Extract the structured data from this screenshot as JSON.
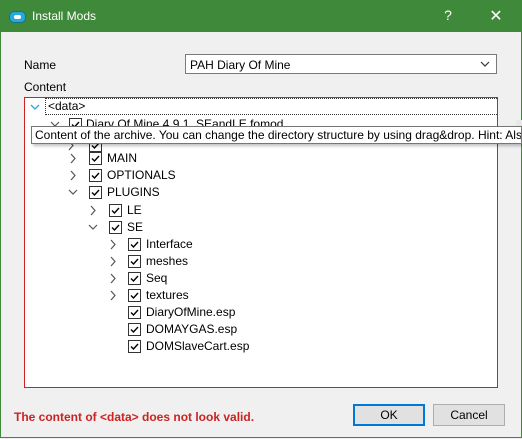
{
  "window": {
    "title": "Install Mods",
    "help_glyph": "?",
    "close_glyph": "✕"
  },
  "form": {
    "name_label": "Name",
    "name_value": "PAH Diary Of Mine",
    "content_label": "Content"
  },
  "tree": {
    "root_label": "<data>",
    "archive_label": "Diary Of Mine 4.9.1_SEandLE.fomod",
    "items": [
      {
        "label": "MAIN",
        "checked": true
      },
      {
        "label": "OPTIONALS",
        "checked": true
      },
      {
        "label": "PLUGINS",
        "checked": true
      },
      {
        "label": "LE",
        "checked": true
      },
      {
        "label": "SE",
        "checked": true
      },
      {
        "label": "Interface",
        "checked": true
      },
      {
        "label": "meshes",
        "checked": true
      },
      {
        "label": "Seq",
        "checked": true
      },
      {
        "label": "textures",
        "checked": true
      },
      {
        "label": "DiaryOfMine.esp",
        "checked": true
      },
      {
        "label": "DOMAYGAS.esp",
        "checked": true
      },
      {
        "label": "DOMSlaveCart.esp",
        "checked": true
      }
    ]
  },
  "tooltip": {
    "text": "Content of the archive. You can change the directory structure by using drag&drop. Hint: Als"
  },
  "status": {
    "error_message": "The content of <data> does not look valid."
  },
  "buttons": {
    "ok": "OK",
    "cancel": "Cancel"
  },
  "colors": {
    "titlebar": "#3f8a3a",
    "error": "#cc2222",
    "focus": "#0078d7"
  }
}
